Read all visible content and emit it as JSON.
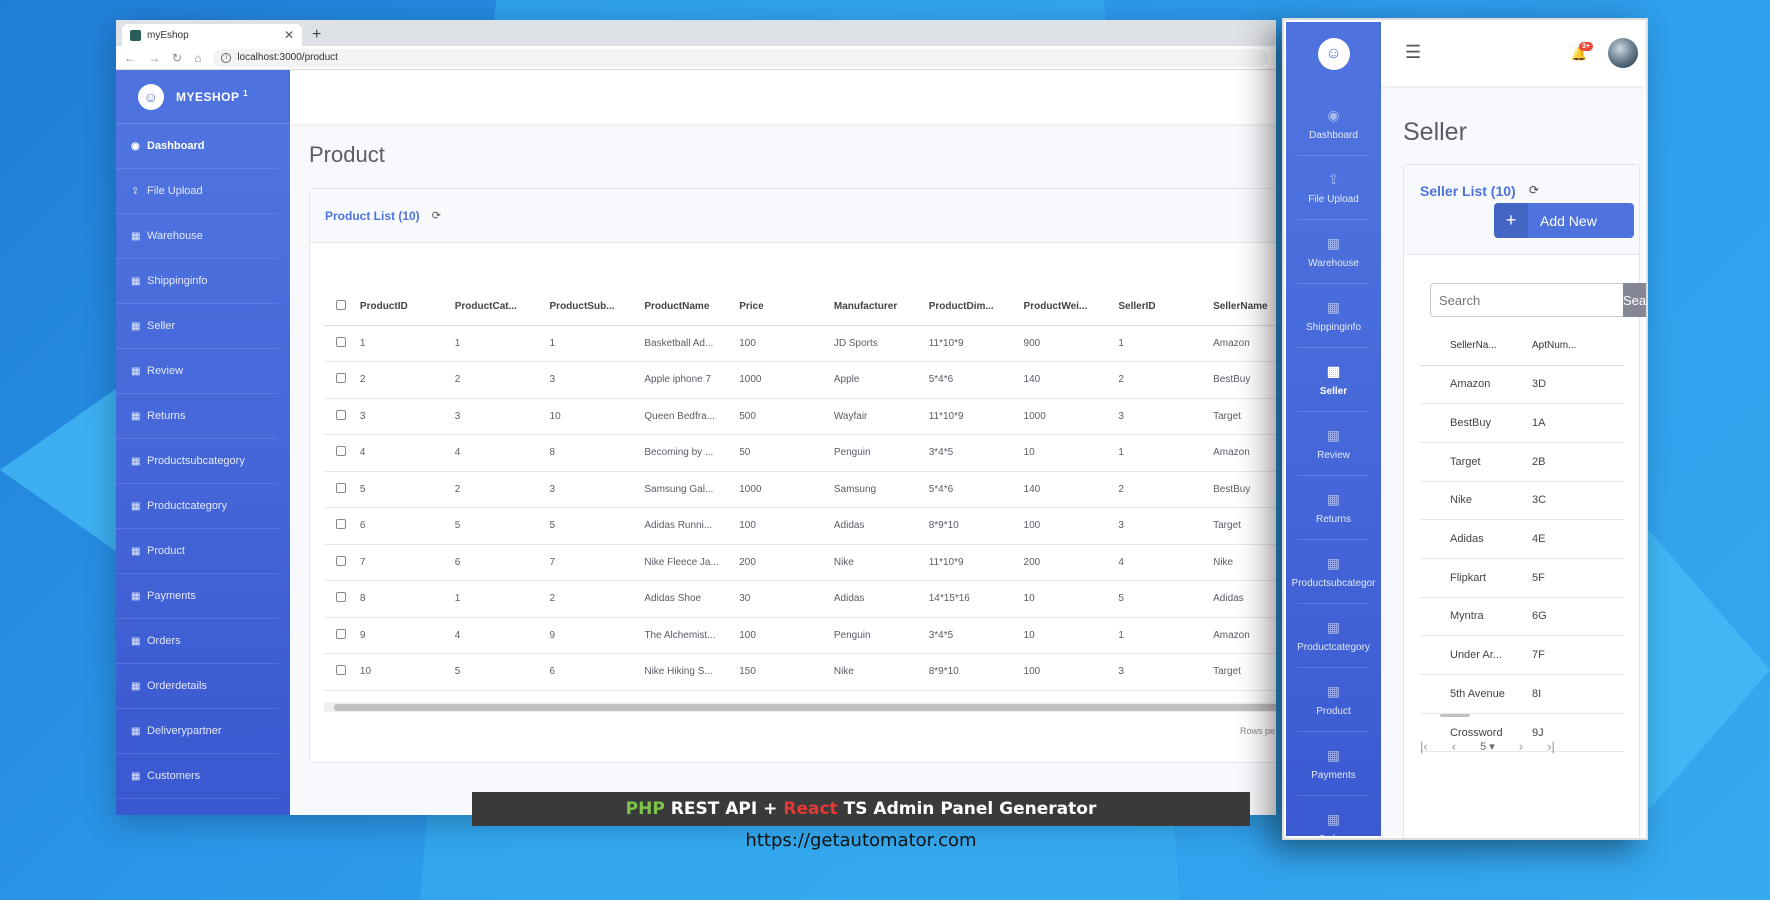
{
  "browser": {
    "tab_title": "myEshop",
    "url": "localhost:3000/product"
  },
  "brand": {
    "name": "MYESHOP",
    "sup": "1"
  },
  "sidebar": {
    "items": [
      {
        "label": "Dashboard",
        "icon": "gauge-icon"
      },
      {
        "label": "File Upload",
        "icon": "upload-icon"
      },
      {
        "label": "Warehouse",
        "icon": "table-icon"
      },
      {
        "label": "Shippinginfo",
        "icon": "table-icon"
      },
      {
        "label": "Seller",
        "icon": "table-icon"
      },
      {
        "label": "Review",
        "icon": "table-icon"
      },
      {
        "label": "Returns",
        "icon": "table-icon"
      },
      {
        "label": "Productsubcategory",
        "icon": "table-icon"
      },
      {
        "label": "Productcategory",
        "icon": "table-icon"
      },
      {
        "label": "Product",
        "icon": "table-icon"
      },
      {
        "label": "Payments",
        "icon": "table-icon"
      },
      {
        "label": "Orders",
        "icon": "table-icon"
      },
      {
        "label": "Orderdetails",
        "icon": "table-icon"
      },
      {
        "label": "Deliverypartner",
        "icon": "table-icon"
      },
      {
        "label": "Customers",
        "icon": "table-icon"
      }
    ]
  },
  "product": {
    "page_title": "Product",
    "list_title": "Product List (10)",
    "search_stub": "S",
    "columns": [
      "ProductID",
      "ProductCat...",
      "ProductSub...",
      "ProductName",
      "Price",
      "Manufacturer",
      "ProductDim...",
      "ProductWei...",
      "SellerID",
      "SellerName"
    ],
    "rows": [
      [
        "1",
        "1",
        "1",
        "Basketball Ad...",
        "100",
        "JD Sports",
        "11*10*9",
        "900",
        "1",
        "Amazon"
      ],
      [
        "2",
        "2",
        "3",
        "Apple iphone 7",
        "1000",
        "Apple",
        "5*4*6",
        "140",
        "2",
        "BestBuy"
      ],
      [
        "3",
        "3",
        "10",
        "Queen Bedfra...",
        "500",
        "Wayfair",
        "11*10*9",
        "1000",
        "3",
        "Target"
      ],
      [
        "4",
        "4",
        "8",
        "Becoming by ...",
        "50",
        "Penguin",
        "3*4*5",
        "10",
        "1",
        "Amazon"
      ],
      [
        "5",
        "2",
        "3",
        "Samsung Gal...",
        "1000",
        "Samsung",
        "5*4*6",
        "140",
        "2",
        "BestBuy"
      ],
      [
        "6",
        "5",
        "5",
        "Adidas Runni...",
        "100",
        "Adidas",
        "8*9*10",
        "100",
        "3",
        "Target"
      ],
      [
        "7",
        "6",
        "7",
        "Nike Fleece Ja...",
        "200",
        "Nike",
        "11*10*9",
        "200",
        "4",
        "Nike"
      ],
      [
        "8",
        "1",
        "2",
        "Adidas Shoe",
        "30",
        "Adidas",
        "14*15*16",
        "10",
        "5",
        "Adidas"
      ],
      [
        "9",
        "4",
        "9",
        "The Alchemist...",
        "100",
        "Penguin",
        "3*4*5",
        "10",
        "1",
        "Amazon"
      ],
      [
        "10",
        "5",
        "6",
        "Nike Hiking S...",
        "150",
        "Nike",
        "8*9*10",
        "100",
        "3",
        "Target"
      ]
    ],
    "rows_per_page": "Rows pe"
  },
  "panel": {
    "nav": [
      {
        "label": "Dashboard",
        "icon": "gauge-icon"
      },
      {
        "label": "File Upload",
        "icon": "upload-icon"
      },
      {
        "label": "Warehouse",
        "icon": "table-icon"
      },
      {
        "label": "Shippinginfo",
        "icon": "table-icon"
      },
      {
        "label": "Seller",
        "icon": "table-icon"
      },
      {
        "label": "Review",
        "icon": "table-icon"
      },
      {
        "label": "Returns",
        "icon": "table-icon"
      },
      {
        "label": "Productsubcategor",
        "icon": "table-icon"
      },
      {
        "label": "Productcategory",
        "icon": "table-icon"
      },
      {
        "label": "Product",
        "icon": "table-icon"
      },
      {
        "label": "Payments",
        "icon": "table-icon"
      },
      {
        "label": "Orders",
        "icon": "table-icon"
      }
    ],
    "notification_badge": "3+",
    "page_title": "Seller",
    "list_title": "Seller List (10)",
    "add_new": "Add New",
    "search_placeholder": "Search",
    "search_button": "Search",
    "columns": [
      "SellerNa...",
      "AptNum..."
    ],
    "rows": [
      [
        "Amazon",
        "3D"
      ],
      [
        "BestBuy",
        "1A"
      ],
      [
        "Target",
        "2B"
      ],
      [
        "Nike",
        "3C"
      ],
      [
        "Adidas",
        "4E"
      ],
      [
        "Flipkart",
        "5F"
      ],
      [
        "Myntra",
        "6G"
      ],
      [
        "Under Ar...",
        "7F"
      ],
      [
        "5th Avenue",
        "8I"
      ],
      [
        "Crossword",
        "9J"
      ]
    ],
    "page_size": "5"
  },
  "caption": {
    "php": "PHP",
    "rest": "REST API +",
    "react": "React",
    "rest2": "TS Admin Panel Generator",
    "url": "https://getautomator.com"
  },
  "colors": {
    "primary": "#4e73df",
    "php": "#7ec44c",
    "react": "#e53935",
    "badge": "#e74a3b"
  }
}
